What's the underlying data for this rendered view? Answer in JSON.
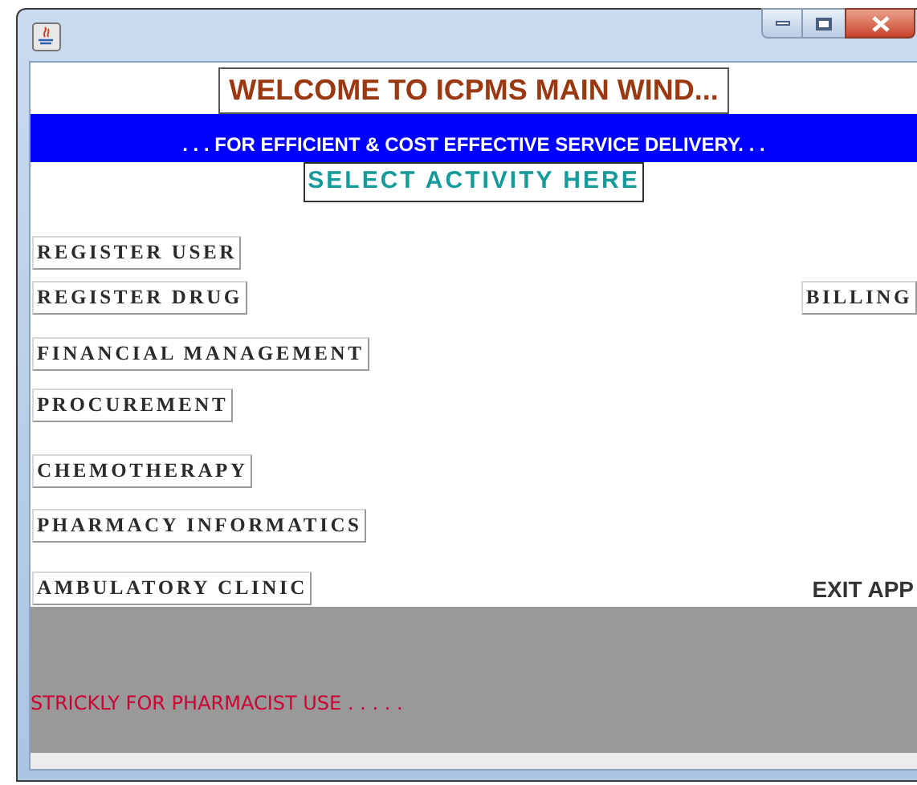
{
  "header": {
    "title": "WELCOME TO ICPMS MAIN WIND...",
    "tagline": ". . . FOR EFFICIENT & COST EFFECTIVE SERVICE DELIVERY. . .",
    "subtitle": "SELECT ACTIVITY HERE"
  },
  "rows": [
    {
      "buttons": [
        {
          "label": "REGISTER USER",
          "kind": "activity"
        }
      ]
    },
    {
      "buttons": [
        {
          "label": "REGISTER DRUG",
          "kind": "activity"
        },
        {
          "label": "BILLING",
          "kind": "activity"
        }
      ]
    },
    {
      "buttons": [
        {
          "label": "FINANCIAL MANAGEMENT",
          "kind": "activity"
        }
      ]
    },
    {
      "buttons": [
        {
          "label": "PROCUREMENT",
          "kind": "activity"
        }
      ]
    },
    {
      "buttons": [
        {
          "label": "CHEMOTHERAPY",
          "kind": "activity"
        }
      ]
    },
    {
      "buttons": [
        {
          "label": "PHARMACY INFORMATICS",
          "kind": "activity"
        }
      ]
    },
    {
      "buttons": [
        {
          "label": "AMBULATORY CLINIC",
          "kind": "activity"
        },
        {
          "label": "EXIT APP",
          "kind": "plain"
        }
      ]
    }
  ],
  "footer": {
    "notice": "STRICKLY FOR PHARMACIST USE . . . . ."
  }
}
